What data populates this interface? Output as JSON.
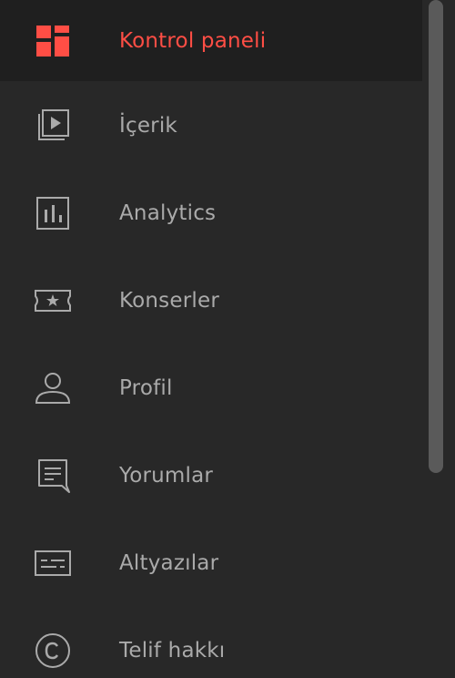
{
  "sidebar": {
    "accent_color": "#ff4e45",
    "text_color": "#aaaaaa",
    "items": [
      {
        "label": "Kontrol paneli",
        "icon": "dashboard-icon",
        "active": true
      },
      {
        "label": "İçerik",
        "icon": "content-icon",
        "active": false
      },
      {
        "label": "Analytics",
        "icon": "analytics-icon",
        "active": false
      },
      {
        "label": "Konserler",
        "icon": "ticket-icon",
        "active": false
      },
      {
        "label": "Profil",
        "icon": "profile-icon",
        "active": false
      },
      {
        "label": "Yorumlar",
        "icon": "comments-icon",
        "active": false
      },
      {
        "label": "Altyazılar",
        "icon": "subtitles-icon",
        "active": false
      },
      {
        "label": "Telif hakkı",
        "icon": "copyright-icon",
        "active": false
      }
    ]
  }
}
